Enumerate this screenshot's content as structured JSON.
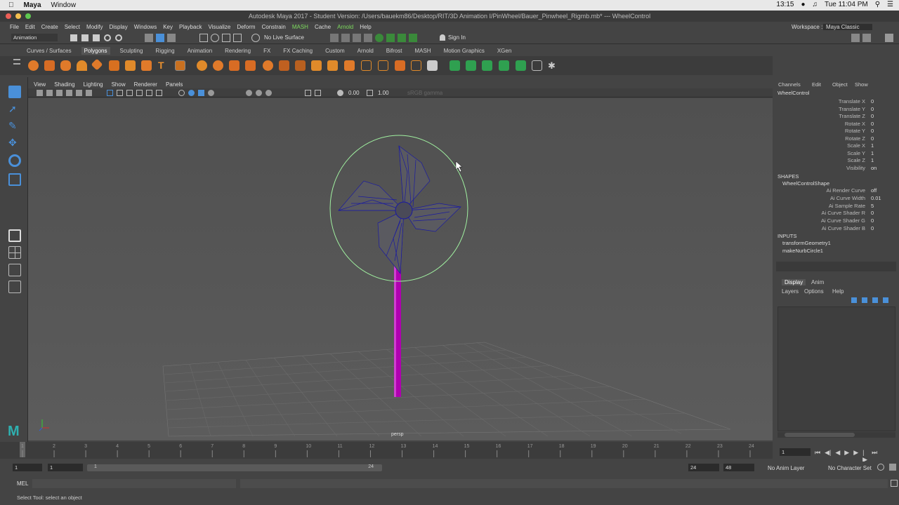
{
  "mac": {
    "app": "Maya",
    "menu": "Window",
    "battery": "13:15",
    "datetime": "Tue 11:04 PM"
  },
  "window": {
    "title": "Autodesk Maya 2017 - Student Version: /Users/bauekm86/Desktop/RIT/3D Animation I/PinWheel/Bauer_Pinwheel_Rigmb.mb*   ---   WheelControl",
    "workspace_label": "Workspace :",
    "workspace_value": "Maya Classic"
  },
  "menus": [
    "File",
    "Edit",
    "Create",
    "Select",
    "Modify",
    "Display",
    "Windows",
    "Key",
    "Playback",
    "Visualize",
    "Deform",
    "Constrain",
    "MASH",
    "Cache",
    "Arnold",
    "Help"
  ],
  "status": {
    "menuset": "Animation",
    "live_surface": "No Live Surface",
    "sign_in": "Sign In"
  },
  "shelf_tabs": [
    "Curves / Surfaces",
    "Polygons",
    "Sculpting",
    "Rigging",
    "Animation",
    "Rendering",
    "FX",
    "FX Caching",
    "Custom",
    "Arnold",
    "Bifrost",
    "MASH",
    "Motion Graphics",
    "XGen"
  ],
  "viewport": {
    "menus": [
      "View",
      "Shading",
      "Lighting",
      "Show",
      "Renderer",
      "Panels"
    ],
    "exposure": "0.00",
    "gamma": "1.00",
    "colorspace": "sRGB gamma",
    "camera_label": "persp"
  },
  "channel_box": {
    "menus": [
      "Channels",
      "Edit",
      "Object",
      "Show"
    ],
    "object": "WheelControl",
    "attributes": [
      {
        "name": "Translate X",
        "value": "0"
      },
      {
        "name": "Translate Y",
        "value": "0"
      },
      {
        "name": "Translate Z",
        "value": "0"
      },
      {
        "name": "Rotate X",
        "value": "0"
      },
      {
        "name": "Rotate Y",
        "value": "0"
      },
      {
        "name": "Rotate Z",
        "value": "0"
      },
      {
        "name": "Scale X",
        "value": "1"
      },
      {
        "name": "Scale Y",
        "value": "1"
      },
      {
        "name": "Scale Z",
        "value": "1"
      },
      {
        "name": "Visibility",
        "value": "on"
      }
    ],
    "shapes_header": "SHAPES",
    "shape_name": "WheelControlShape",
    "shape_attributes": [
      {
        "name": "Ai Render Curve",
        "value": "off"
      },
      {
        "name": "Ai Curve Width",
        "value": "0.01"
      },
      {
        "name": "Ai Sample Rate",
        "value": "5"
      },
      {
        "name": "Ai Curve Shader R",
        "value": "0"
      },
      {
        "name": "Ai Curve Shader G",
        "value": "0"
      },
      {
        "name": "Ai Curve Shader B",
        "value": "0"
      }
    ],
    "inputs_header": "INPUTS",
    "inputs": [
      "transformGeometry1",
      "makeNurbCircle1"
    ]
  },
  "layer_editor": {
    "tabs": [
      "Display",
      "Anim"
    ],
    "menus": [
      "Layers",
      "Options",
      "Help"
    ]
  },
  "timeline": {
    "ticks": [
      "1",
      "2",
      "3",
      "4",
      "5",
      "6",
      "7",
      "8",
      "9",
      "10",
      "11",
      "12",
      "13",
      "14",
      "15",
      "16",
      "17",
      "18",
      "19",
      "20",
      "21",
      "22",
      "23",
      "24"
    ],
    "current_frame": "1"
  },
  "range": {
    "start": "1",
    "playback_start": "1",
    "slider_start": "1",
    "slider_end": "24",
    "playback_end": "24",
    "end": "48",
    "anim_layer": "No Anim Layer",
    "character_set": "No Character Set"
  },
  "mel": {
    "label": "MEL"
  },
  "help_line": "Select Tool: select an object",
  "colors": {
    "pole": "#b000b0",
    "control_circle": "#a0f0a0",
    "wireframe": "#1a1aa0",
    "accent": "#4a90d9"
  }
}
